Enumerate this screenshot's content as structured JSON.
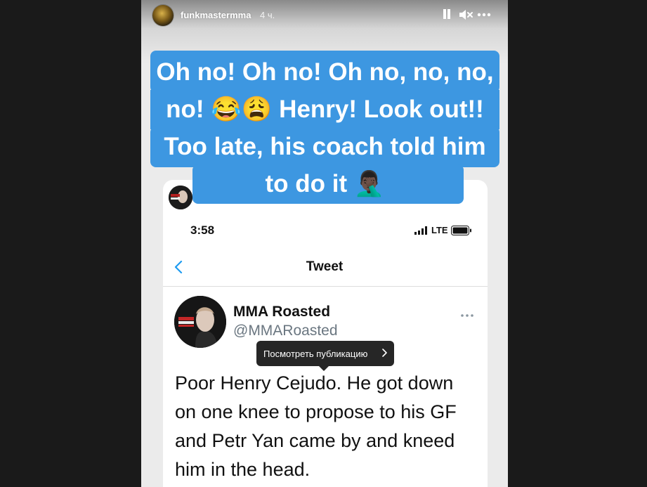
{
  "story": {
    "username": "funkmastermma",
    "time_ago": "4 ч.",
    "caption": "Oh no! Oh no! Oh no, no, no, no! 😂😩 Henry! Look out!! Too late, his coach told him to do it 🤦🏿‍♂️",
    "caption_color": "#3d97e1",
    "controls": [
      "pause-icon",
      "mute-icon",
      "more-icon"
    ]
  },
  "tweet": {
    "status_time": "3:58",
    "network": "LTE",
    "nav_title": "Tweet",
    "display_name": "MMA Roasted",
    "handle": "@MMARoasted",
    "body": "Poor Henry Cejudo. He got down on one knee to propose to his GF and Petr Yan came by and kneed him in the head."
  },
  "tooltip": {
    "label": "Посмотреть публикацию"
  }
}
